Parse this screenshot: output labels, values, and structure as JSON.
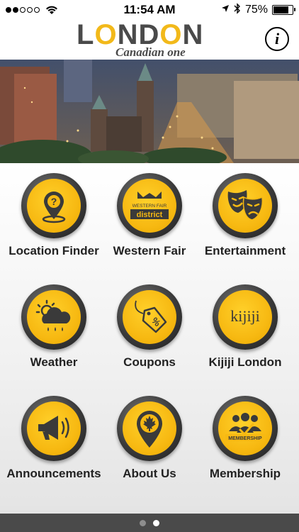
{
  "status_bar": {
    "time": "11:54 AM",
    "battery_text": "75%",
    "battery_level": 0.75
  },
  "header": {
    "logo_main_1": "L",
    "logo_main_o1": "O",
    "logo_main_2": "ND",
    "logo_main_o2": "O",
    "logo_main_3": "N",
    "logo_sub": "Canadian one",
    "info_label": "i"
  },
  "tiles": [
    {
      "label": "Location Finder",
      "icon": "location-question-icon"
    },
    {
      "label": "Western Fair",
      "icon": "western-fair-district-icon",
      "icon_text_1": "WESTERN FAIR",
      "icon_text_2": "district"
    },
    {
      "label": "Entertainment",
      "icon": "theater-masks-icon"
    },
    {
      "label": "Weather",
      "icon": "weather-cloud-icon"
    },
    {
      "label": "Coupons",
      "icon": "coupon-tag-icon",
      "icon_text": "%"
    },
    {
      "label": "Kijiji London",
      "icon": "kijiji-icon",
      "icon_text": "kijiji"
    },
    {
      "label": "Announcements",
      "icon": "megaphone-icon"
    },
    {
      "label": "About Us",
      "icon": "maple-leaf-pin-icon"
    },
    {
      "label": "Membership",
      "icon": "membership-icon",
      "icon_text": "MEMBERSHIP"
    }
  ],
  "pager": {
    "count": 2,
    "active": 2
  },
  "colors": {
    "accent": "#f7b912",
    "dark": "#4a4a4a"
  }
}
